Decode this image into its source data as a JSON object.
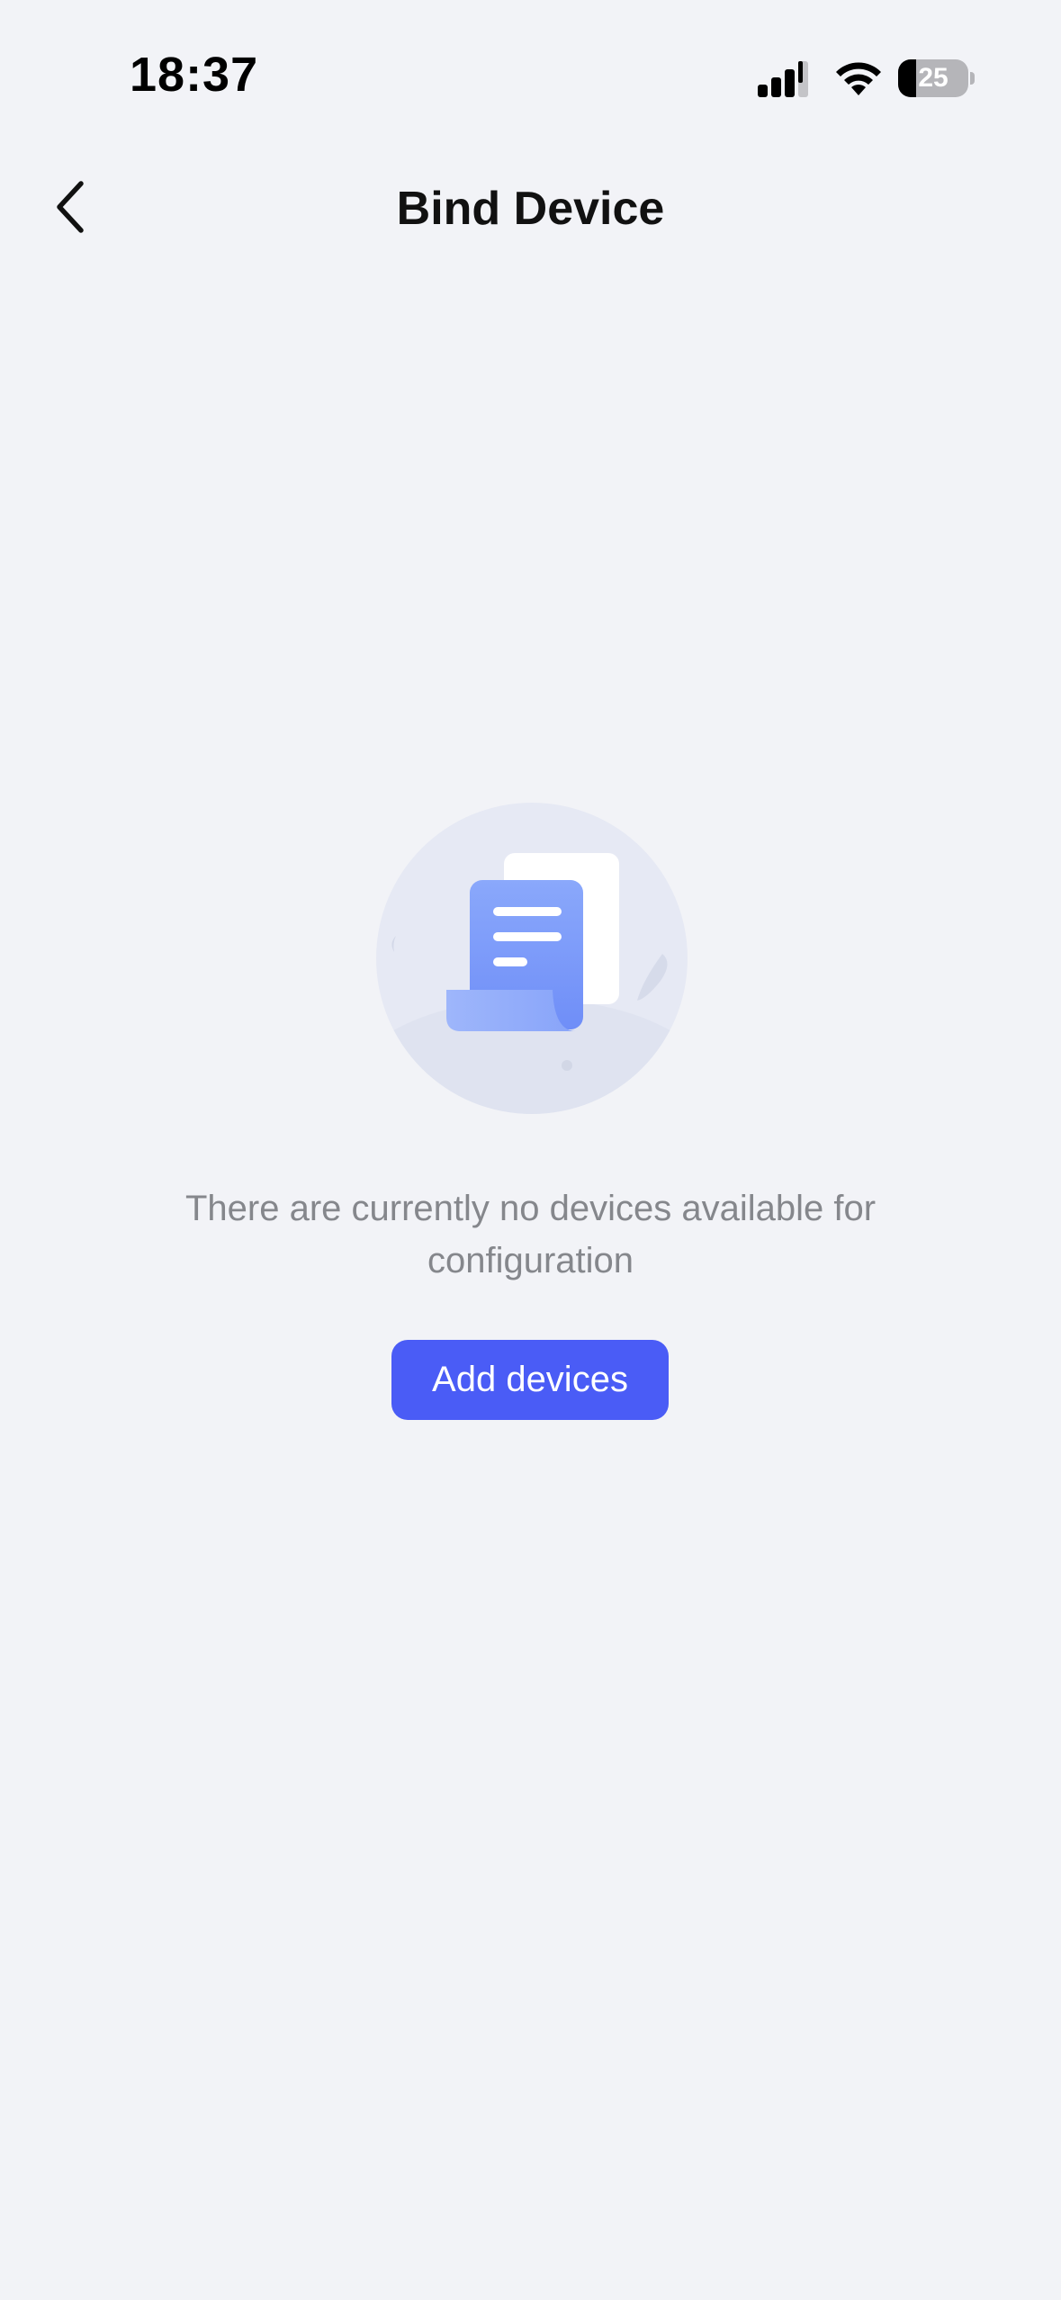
{
  "status_bar": {
    "time": "18:37",
    "battery_level": "25",
    "battery_fraction": 0.25,
    "icons": [
      "signal-icon",
      "wifi-icon",
      "battery-icon"
    ]
  },
  "header": {
    "title": "Bind Device",
    "back_icon": "chevron-left-icon"
  },
  "empty_state": {
    "illustration": "empty-document-illustration",
    "message": "There are currently no devices available for configuration",
    "button_label": "Add devices"
  },
  "colors": {
    "background": "#f2f3f7",
    "accent": "#4a5cf6",
    "message_text": "#85878c"
  }
}
